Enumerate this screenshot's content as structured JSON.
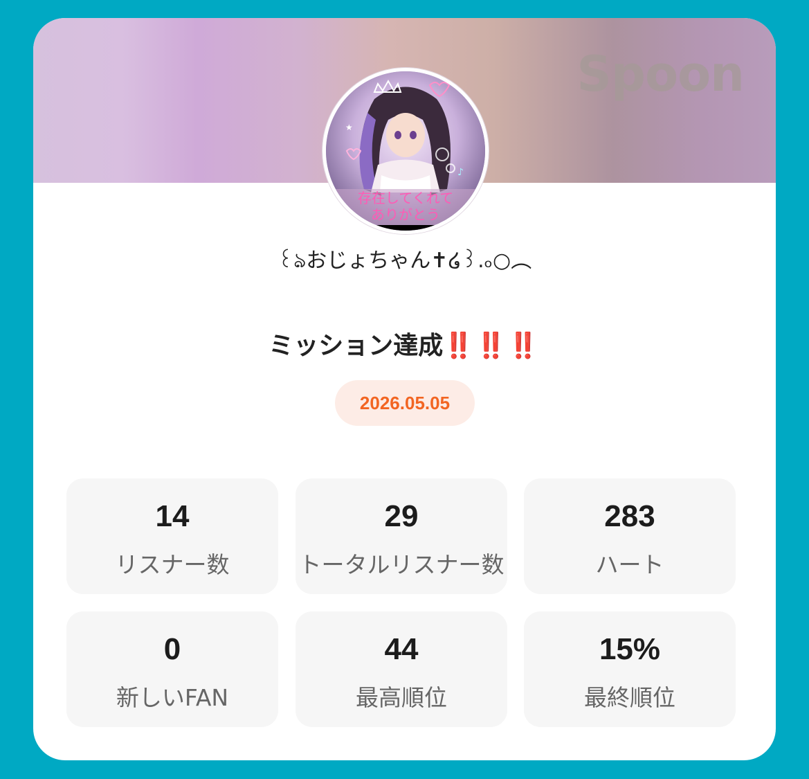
{
  "brand": "Spoon",
  "profile": {
    "username": "꒰ঌおじょちゃん✝໒꒱.ₒ○︵",
    "avatar_caption_line1": "存在してくれて",
    "avatar_caption_line2": "ありがとう"
  },
  "mission": {
    "title": "ミッション達成",
    "marks": "‼️‼️‼️",
    "date": "2026.05.05"
  },
  "stats": [
    {
      "value": "14",
      "label": "リスナー数"
    },
    {
      "value": "29",
      "label": "トータルリスナー数"
    },
    {
      "value": "283",
      "label": "ハート"
    },
    {
      "value": "0",
      "label": "新しいFAN"
    },
    {
      "value": "44",
      "label": "最高順位"
    },
    {
      "value": "15%",
      "label": "最終順位"
    }
  ],
  "colors": {
    "background": "#00a9c3",
    "accent_date": "#f26522",
    "exclamation": "#e0132a"
  }
}
